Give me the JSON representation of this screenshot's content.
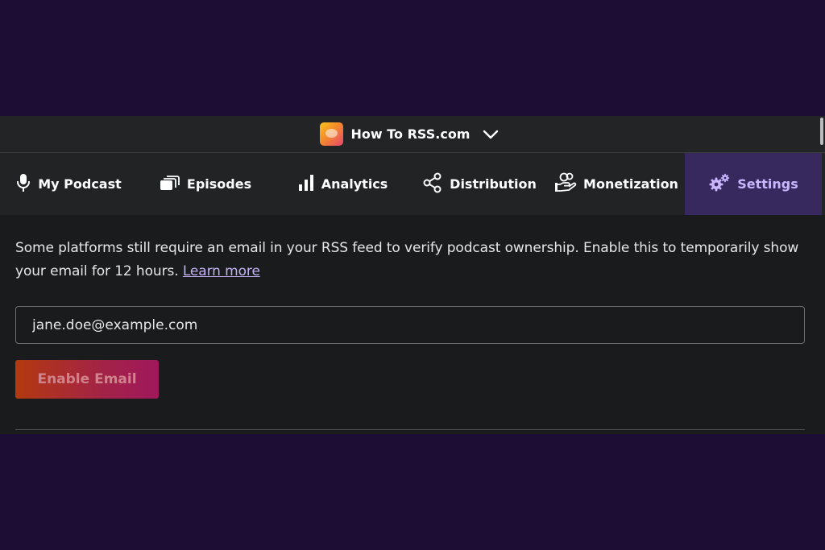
{
  "header": {
    "podcast_name": "How To RSS.com",
    "logo_icon": "podcast-cover-art",
    "dropdown_icon": "chevron-down-icon"
  },
  "nav": {
    "tabs": [
      {
        "label": "My Podcast",
        "icon": "microphone-icon",
        "active": false
      },
      {
        "label": "Episodes",
        "icon": "episodes-stack-icon",
        "active": false
      },
      {
        "label": "Analytics",
        "icon": "bar-chart-icon",
        "active": false
      },
      {
        "label": "Distribution",
        "icon": "share-icon",
        "active": false
      },
      {
        "label": "Monetization",
        "icon": "hand-coins-icon",
        "active": false
      },
      {
        "label": "Settings",
        "icon": "gears-icon",
        "active": true
      }
    ]
  },
  "email_section": {
    "description": "Some platforms still require an email in your RSS feed to verify podcast ownership. Enable this to temporarily show your email for 12 hours.",
    "learn_more": "Learn more",
    "email_value": "jane.doe@example.com",
    "enable_button": "Enable Email"
  },
  "colors": {
    "page_background": "#1d0c33",
    "panel_background": "#191b1d",
    "active_tab_background": "#37295e",
    "active_tab_text": "#c9b6ff",
    "link": "#c2b2f3",
    "button_gradient_start": "#b3390f",
    "button_gradient_end": "#a0185c"
  }
}
